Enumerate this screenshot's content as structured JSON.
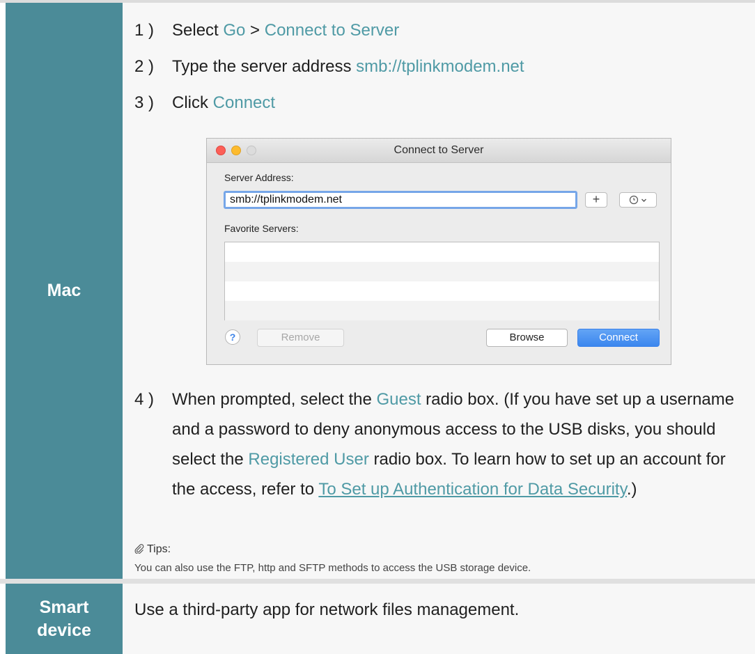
{
  "mac_row": {
    "label": "Mac",
    "steps": [
      {
        "num": "1 )",
        "text_before": "Select ",
        "hl1": "Go",
        "mid": " > ",
        "hl2": "Connect to Server"
      },
      {
        "num": "2 )",
        "text_before": "Type the server address ",
        "hl": "smb://tplinkmodem.net"
      },
      {
        "num": "3 )",
        "text_before": "Click ",
        "hl": "Connect"
      }
    ],
    "step4": {
      "num": "4 )",
      "t1": "When prompted, select the ",
      "hl_guest": "Guest",
      "t2": " radio box. (If you have set up a username and a password to deny anonymous access to the USB disks, you should select the ",
      "hl_registered": "Registered User",
      "t3": " radio box. To learn how to set up an account for the access, refer to ",
      "link": "To Set up Authentication for Data Security",
      "t4": ".)"
    },
    "tips_title": "Tips:",
    "tips_text": "You can also use the FTP, http and SFTP methods to access the USB storage device."
  },
  "dialog": {
    "title": "Connect to Server",
    "server_address_label": "Server Address:",
    "server_address_value": "smb://tplinkmodem.net",
    "favorite_servers_label": "Favorite Servers:",
    "plus_label": "+",
    "help_label": "?",
    "remove_label": "Remove",
    "browse_label": "Browse",
    "connect_label": "Connect",
    "favorite_rows": 4
  },
  "smart_row": {
    "label_line1": "Smart",
    "label_line2": "device",
    "text": "Use a third-party app for network files management."
  },
  "colors": {
    "label_bg": "#4b8b98",
    "highlight": "#4f9aa5",
    "content_bg": "#f7f7f7",
    "connect_button": "#3b86ee"
  }
}
